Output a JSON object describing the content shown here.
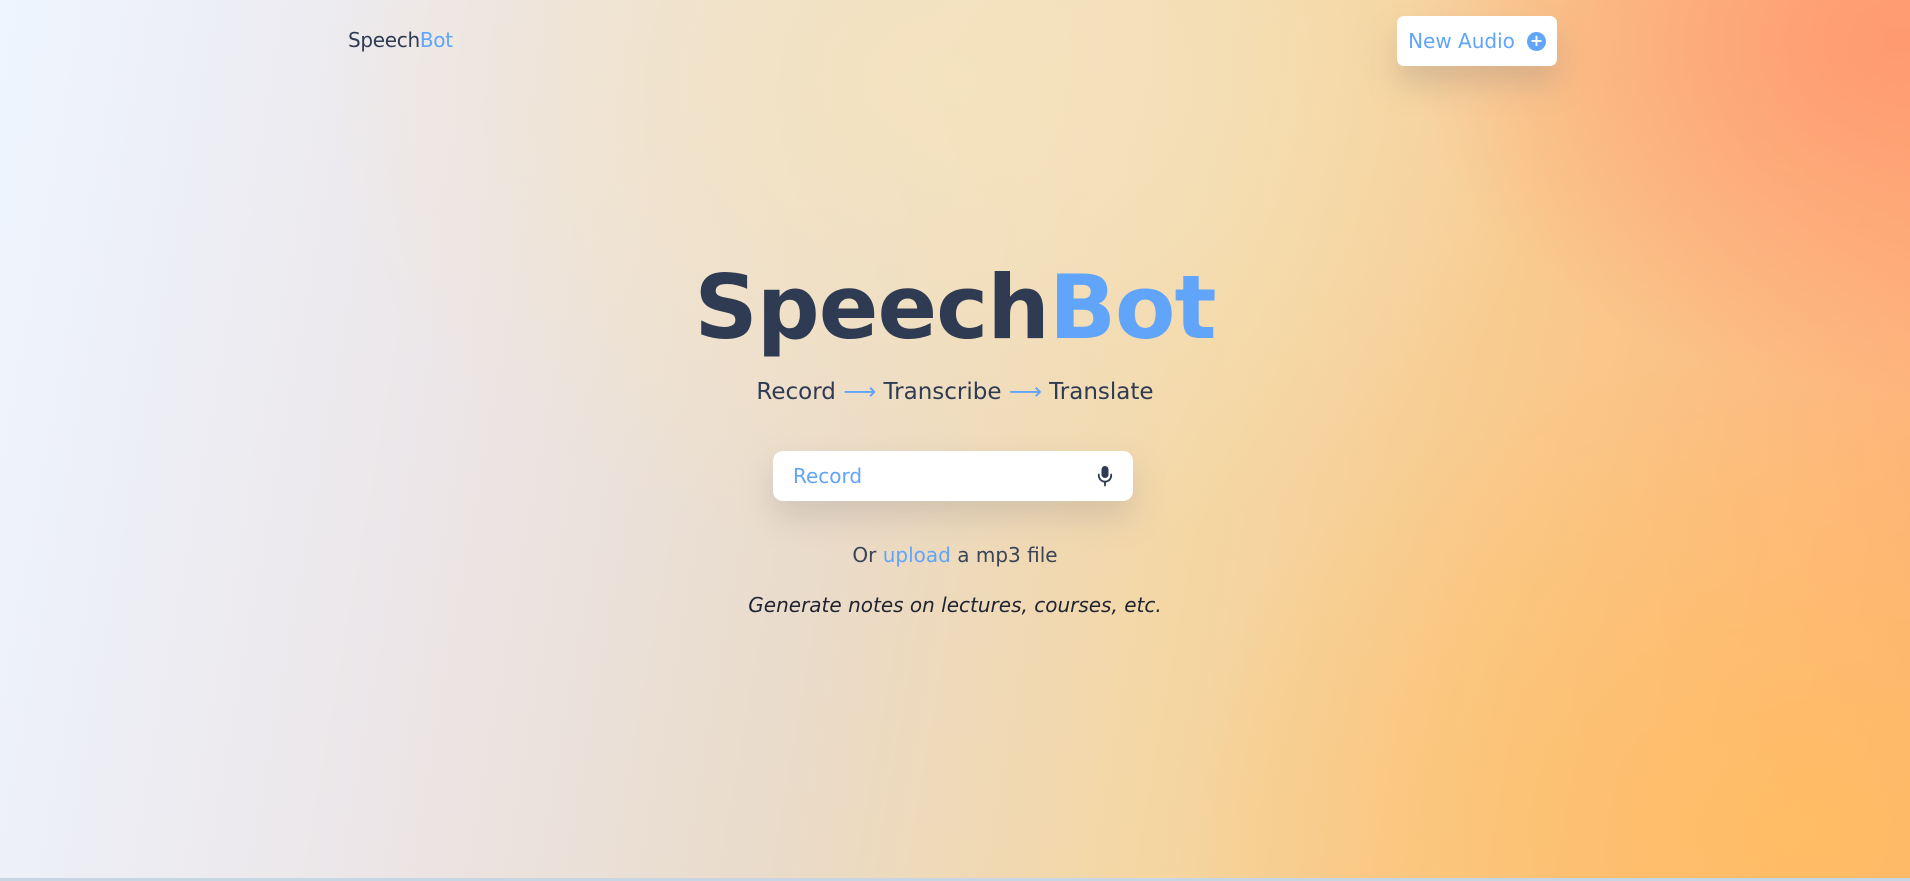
{
  "header": {
    "logo_part1": "Speech",
    "logo_part2": "Bot",
    "new_audio_label": "New Audio",
    "new_audio_icon": "plus-circle-icon"
  },
  "hero": {
    "title_part1": "Speech",
    "title_part2": "Bot",
    "tagline": {
      "step1": "Record",
      "arrow1": "⟶",
      "step2": "Transcribe",
      "arrow2": "⟶",
      "step3": "Translate"
    }
  },
  "record": {
    "label": "Record",
    "icon": "microphone-icon"
  },
  "upload": {
    "prefix": "Or",
    "link": "upload",
    "suffix": "a mp3 file"
  },
  "note": "Generate notes on lectures, courses, etc.",
  "colors": {
    "accent": "#60a5fa",
    "text_dark": "#2f3b52"
  }
}
